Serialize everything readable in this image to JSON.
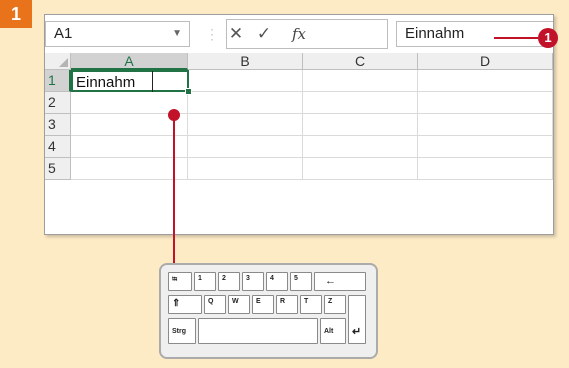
{
  "step": "1",
  "formula_bar": {
    "name_box": "A1",
    "name_box_dropdown_icon": "chevron-down-icon",
    "separator": "⋮",
    "cancel_icon": "✕",
    "enter_icon": "✓",
    "fx_label": "fx",
    "formula_value": "Einnahm"
  },
  "grid": {
    "columns": [
      "A",
      "B",
      "C",
      "D"
    ],
    "rows": [
      "1",
      "2",
      "3",
      "4",
      "5"
    ],
    "active_cell": "A1",
    "cell_A1": "Einnahm"
  },
  "callout": {
    "number": "1",
    "color": "#c2122a"
  },
  "keyboard": {
    "keys_row1": [
      "⭾",
      "1",
      "2",
      "3",
      "4",
      "5",
      "←"
    ],
    "keys_row2": [
      "⇑",
      "Q",
      "W",
      "E",
      "R",
      "T",
      "Z"
    ],
    "keys_row3": [
      "Strg",
      "",
      "Alt",
      "↵"
    ]
  },
  "colors": {
    "background": "#fdebc6",
    "accent": "#e8731a",
    "excel_green": "#217346",
    "callout_red": "#c2122a"
  }
}
